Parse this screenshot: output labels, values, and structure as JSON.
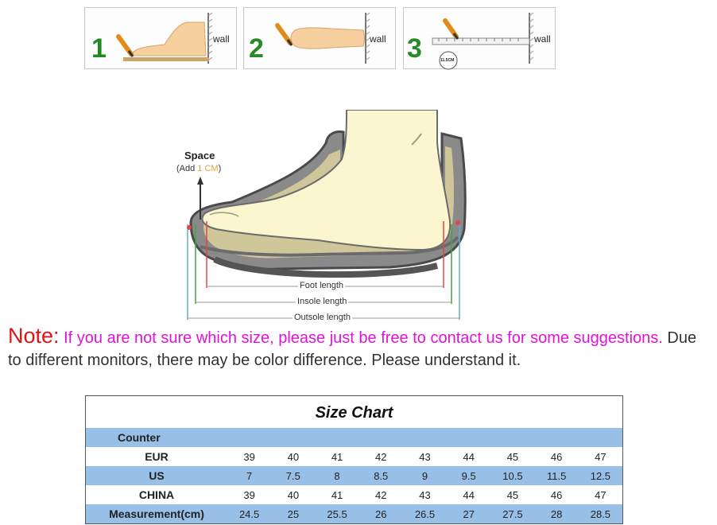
{
  "steps": [
    {
      "number": "1",
      "number_color": "#1f8a1f",
      "wall_label": "wall"
    },
    {
      "number": "2",
      "number_color": "#2a8a2a",
      "wall_label": "wall"
    },
    {
      "number": "3",
      "number_color": "#2a8a2a",
      "wall_label": "wall",
      "readout": "11.5CM"
    }
  ],
  "diagram": {
    "space_title": "Space",
    "space_sub_prefix": "(Add ",
    "space_sub_accent": "1 CM",
    "space_sub_suffix": ")",
    "foot_length": "Foot length",
    "insole_length": "Insole length",
    "outsole_length": "Outsole length"
  },
  "note": {
    "label": "Note:",
    "pink_text": " If you are not sure which size, please just be free to contact us for some suggestions.",
    "gray_text": " Due to different monitors, there may be color difference. Please understand it."
  },
  "colors": {
    "note_label": "#e01414",
    "pink": "#e312d8",
    "table_blue": "#98bfe6"
  },
  "size_chart": {
    "title": "Size Chart",
    "counter_label": "Counter",
    "rows": [
      {
        "label": "EUR",
        "values": [
          "39",
          "40",
          "41",
          "42",
          "43",
          "44",
          "45",
          "46",
          "47"
        ],
        "blue": false
      },
      {
        "label": "US",
        "values": [
          "7",
          "7.5",
          "8",
          "8.5",
          "9",
          "9.5",
          "10.5",
          "11.5",
          "12.5"
        ],
        "blue": true
      },
      {
        "label": "CHINA",
        "values": [
          "39",
          "40",
          "41",
          "42",
          "43",
          "44",
          "45",
          "46",
          "47"
        ],
        "blue": false
      },
      {
        "label": "Measurement(cm)",
        "values": [
          "24.5",
          "25",
          "25.5",
          "26",
          "26.5",
          "27",
          "27.5",
          "28",
          "28.5"
        ],
        "blue": true
      }
    ]
  }
}
